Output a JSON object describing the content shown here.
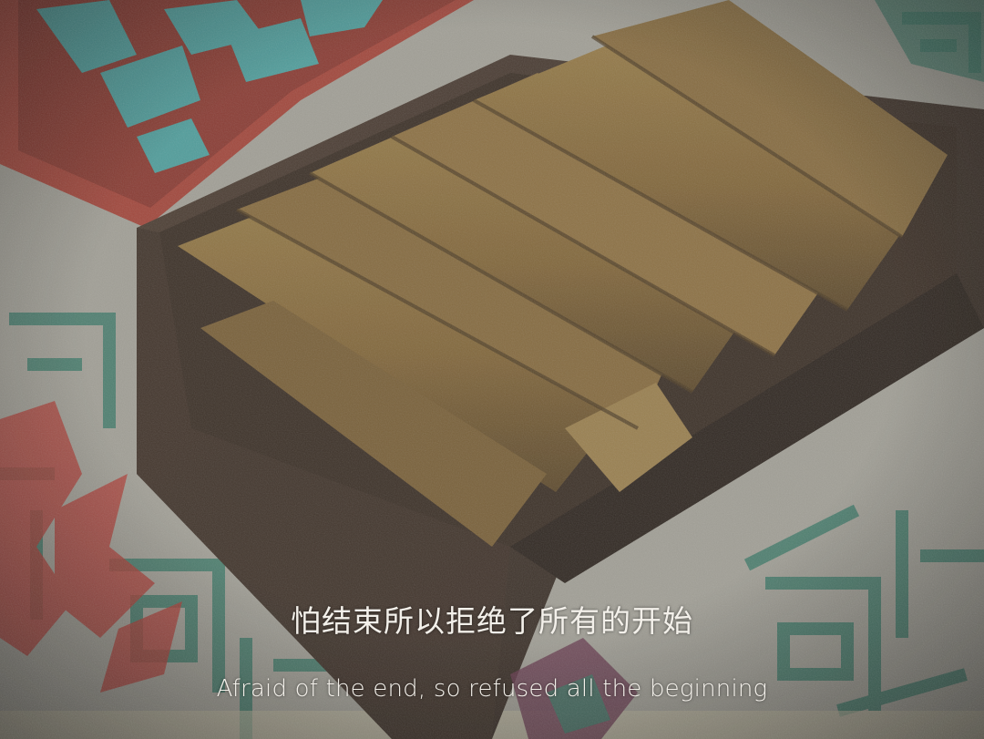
{
  "caption": {
    "chinese": "怕结束所以拒绝了所有的开始",
    "english": "Afraid of the end, so refused all the beginning"
  },
  "palette": {
    "paper": "#b9b7ae",
    "paper_ink": "#3f7f6e",
    "print_red": "#b8413a",
    "lid_red": "#a9463b",
    "lid_cyan": "#4fa5a4",
    "box_brown": "#4a3c31",
    "pastry": "#8f7442"
  }
}
